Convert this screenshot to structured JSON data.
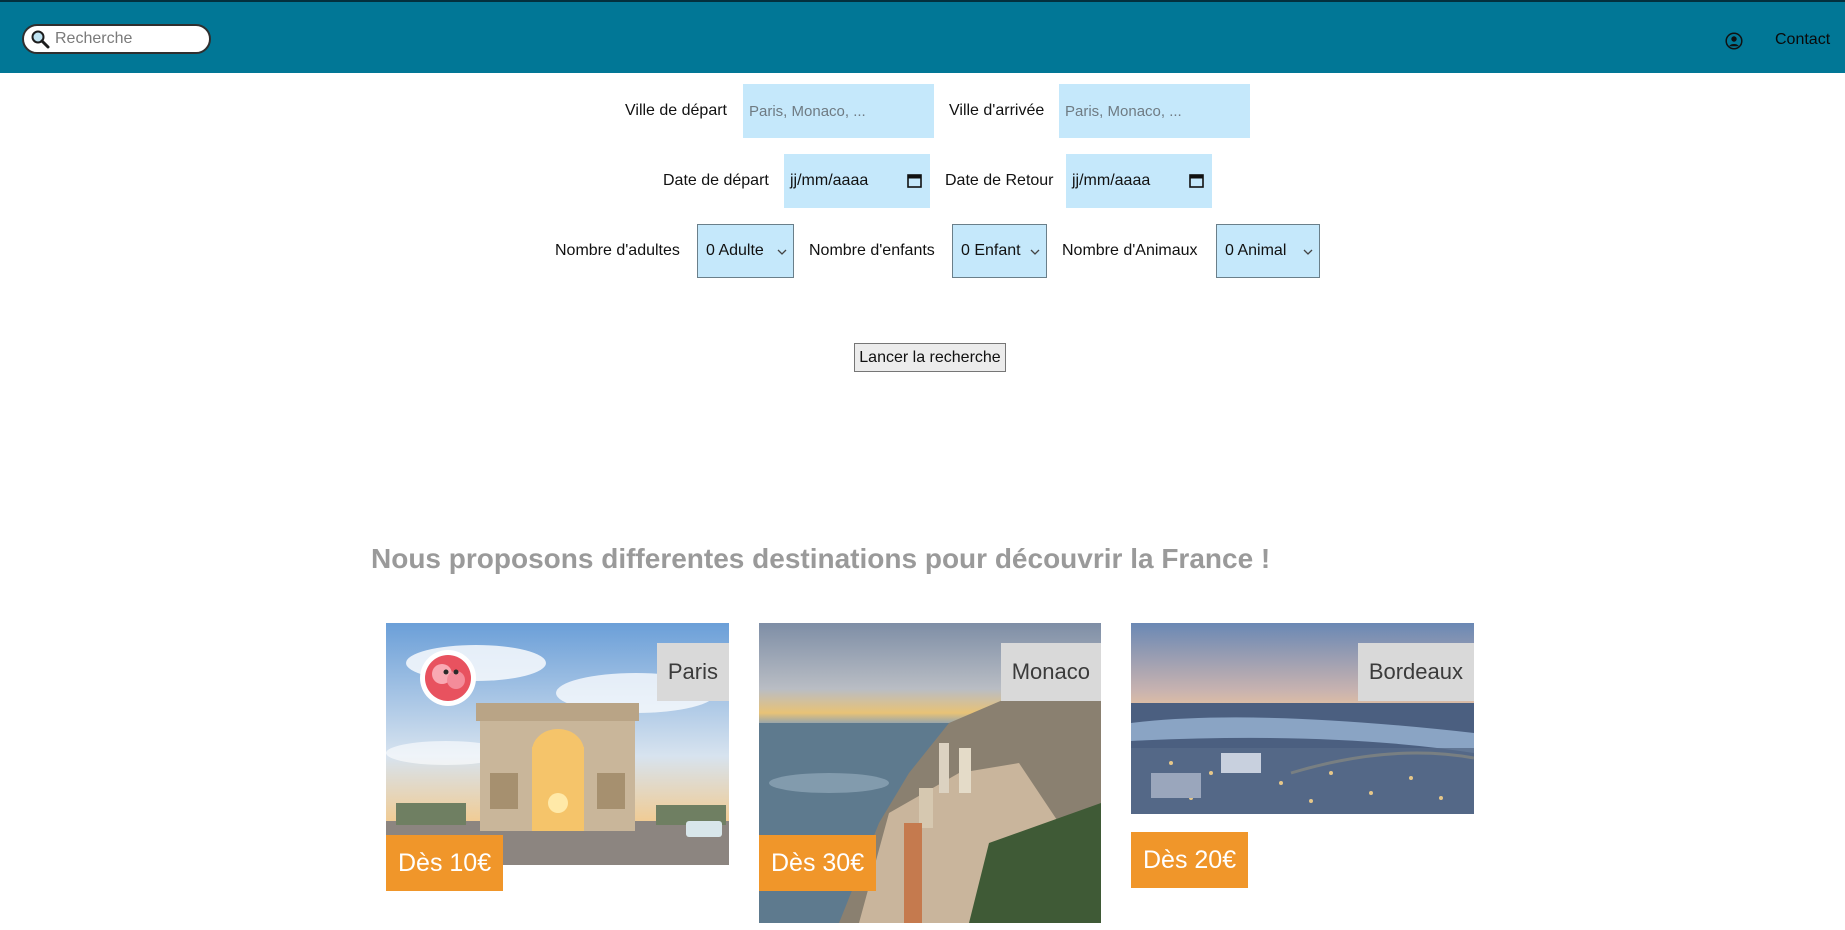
{
  "header": {
    "search_placeholder": "Recherche",
    "contact_label": "Contact",
    "bar_color": "#017796"
  },
  "form": {
    "departure_city_label": "Ville de départ",
    "departure_city_placeholder": "Paris, Monaco, ...",
    "arrival_city_label": "Ville d'arrivée",
    "arrival_city_placeholder": "Paris, Monaco, ...",
    "departure_date_label": "Date de départ",
    "departure_date_value": "jj/mm/aaaa",
    "return_date_label": "Date de Retour",
    "return_date_value": "jj/mm/aaaa",
    "adults_label": "Nombre d'adultes",
    "adults_value": "0 Adulte",
    "children_label": "Nombre d'enfants",
    "children_value": "0 Enfant",
    "animals_label": "Nombre d'Animaux",
    "animals_value": "0 Animal",
    "submit_label": "Lancer la recherche",
    "field_color": "#c5e8fb"
  },
  "destinations": {
    "title": "Nous proposons differentes destinations pour découvrir la France !",
    "cards": [
      {
        "city": "Paris",
        "price": "Dès 10€"
      },
      {
        "city": "Monaco",
        "price": "Dès 30€"
      },
      {
        "city": "Bordeaux",
        "price": "Dès 20€"
      }
    ],
    "price_color": "#f0962a"
  }
}
